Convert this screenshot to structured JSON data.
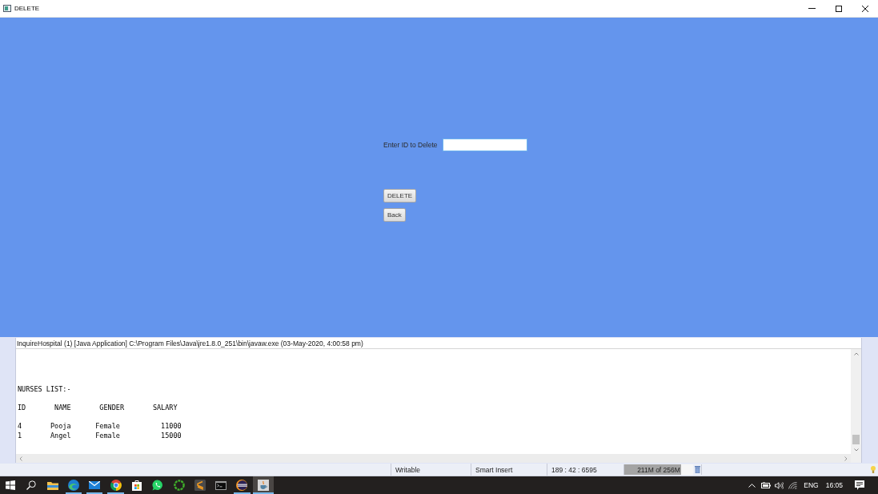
{
  "window": {
    "title": "DELETE"
  },
  "form": {
    "label": "Enter ID to Delete",
    "id_field": {
      "focused": true
    },
    "buttons": [
      "DELETE",
      "Back"
    ]
  },
  "console": {
    "header": "InquireHospital (1) [Java Application] C:\\Program Files\\Java\\jre1.8.0_251\\bin\\javaw.exe (03-May-2020, 4:00:58 pm)",
    "blocks": [
      {
        "lines": [
          "NURSES LIST:-"
        ]
      },
      {
        "lines": [
          "ID       NAME       GENDER       SALARY"
        ]
      },
      {
        "lines": [
          "4       Pooja      Female          11000",
          "1       Angel      Female          15000"
        ]
      }
    ]
  },
  "status_bar": {
    "write_mode": "Writable",
    "insert_mode": "Smart Insert",
    "position": "189 : 42 : 6595",
    "memory": {
      "text": "211M of 256M",
      "level": 0.82
    }
  },
  "taskbar": {
    "apps": [
      {
        "running": false,
        "selected": false
      },
      {
        "running": true,
        "selected": false
      },
      {
        "running": true,
        "selected": false
      },
      {
        "running": true,
        "selected": false
      },
      {
        "running": false,
        "selected": false
      },
      {
        "running": false,
        "selected": false
      },
      {
        "running": false,
        "selected": false
      },
      {
        "running": false,
        "selected": false
      },
      {
        "running": false,
        "selected": false
      },
      {
        "running": true,
        "selected": false
      },
      {
        "running": true,
        "selected": true
      }
    ],
    "tray": {
      "language": "ENG",
      "time": "16:05"
    }
  }
}
